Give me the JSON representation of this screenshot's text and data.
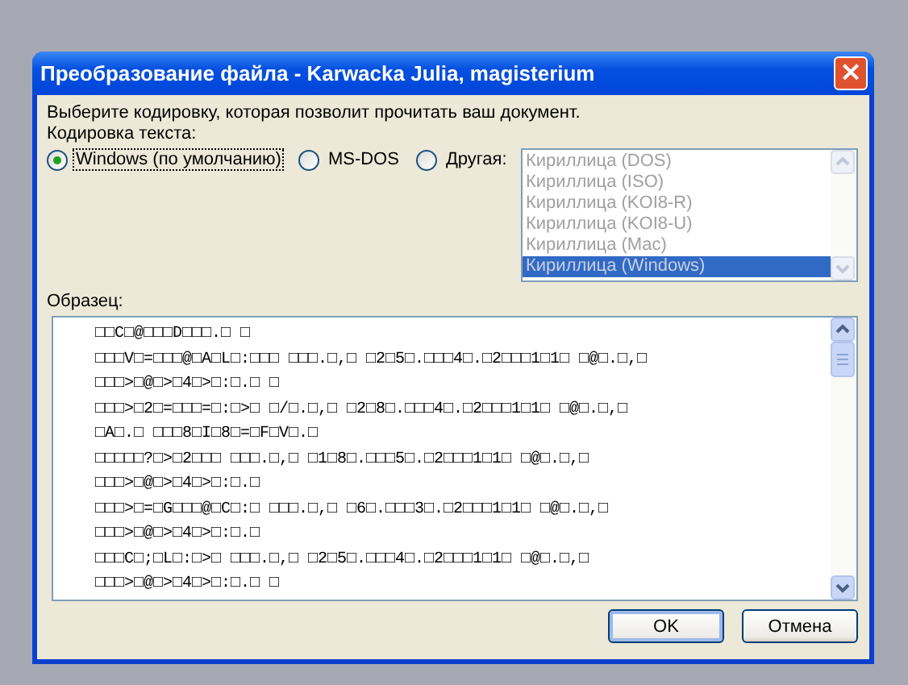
{
  "window": {
    "title": "Преобразование файла - Karwacka Julia, magisterium",
    "close": "×"
  },
  "instruction": "Выберите кодировку, которая позволит прочитать ваш документ.",
  "encoding_label": "Кодировка текста:",
  "radios": [
    {
      "label": "Windows (по умолчанию)",
      "selected": true
    },
    {
      "label": "MS-DOS",
      "selected": false
    },
    {
      "label": "Другая:",
      "selected": false
    }
  ],
  "encoding_list": {
    "disabled": true,
    "items": [
      {
        "label": "Кириллица (DOS)",
        "selected": false
      },
      {
        "label": "Кириллица (ISO)",
        "selected": false
      },
      {
        "label": "Кириллица (KOI8-R)",
        "selected": false
      },
      {
        "label": "Кириллица (KOI8-U)",
        "selected": false
      },
      {
        "label": "Кириллица (Mac)",
        "selected": false
      },
      {
        "label": "Кириллица (Windows)",
        "selected": true
      }
    ]
  },
  "sample_label": "Образец:",
  "sample_lines": [
    "□□C□@□□□D□□□.□ □",
    "□□□V□=□□□@□A□L□:□□□ □□□.□,□ □2□5□.□□□4□.□2□□□1□1□ □@□.□,□",
    "□□□>□@□>□4□>□:□.□ □",
    "□□□>□2□=□□□=□:□>□ □/□.□,□ □2□8□.□□□4□.□2□□□1□1□ □@□.□,□",
    "□A□.□ □□□8□I□8□=□F□V□.□",
    "□□□□□?□>□2□□□ □□□.□,□ □1□8□.□□□5□.□2□□□1□1□ □@□.□,□",
    "□□□>□@□>□4□>□:□.□",
    "□□□>□=□G□□□@□C□:□ □□□.□,□ □6□.□□□3□.□2□□□1□1□ □@□.□,□",
    "□□□>□@□>□4□>□:□.□",
    "□□□C□;□L□:□>□ □□□.□,□ □2□5□.□□□4□.□2□□□1□1□ □@□.□,□",
    "□□□>□@□>□4□>□:□.□ □"
  ],
  "buttons": [
    {
      "label": "OK",
      "default": true
    },
    {
      "label": "Отмена",
      "default": false
    }
  ]
}
